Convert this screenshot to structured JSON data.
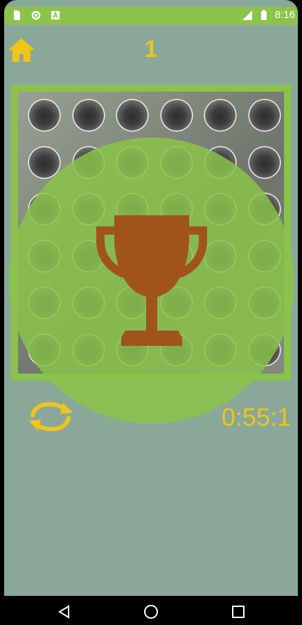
{
  "status_bar": {
    "time": "8:16",
    "left_icons": [
      "sd-card-icon",
      "settings-icon",
      "font-icon"
    ],
    "right_icons": [
      "signal-icon",
      "battery-icon"
    ],
    "color": "#8bc34a"
  },
  "header": {
    "home_icon": "home-icon",
    "level": "1"
  },
  "board": {
    "rows": 6,
    "cols": 6,
    "frame_color": "#8bc34a"
  },
  "overlay": {
    "icon": "trophy-icon",
    "trophy_color": "#a0541c",
    "circle_color": "#8bc34a"
  },
  "controls": {
    "restart_icon": "restart-icon",
    "timer": "0:55:1",
    "accent_color": "#f0c419"
  },
  "nav_bar": {
    "buttons": [
      "back-icon",
      "home-circle-icon",
      "recents-icon"
    ]
  }
}
